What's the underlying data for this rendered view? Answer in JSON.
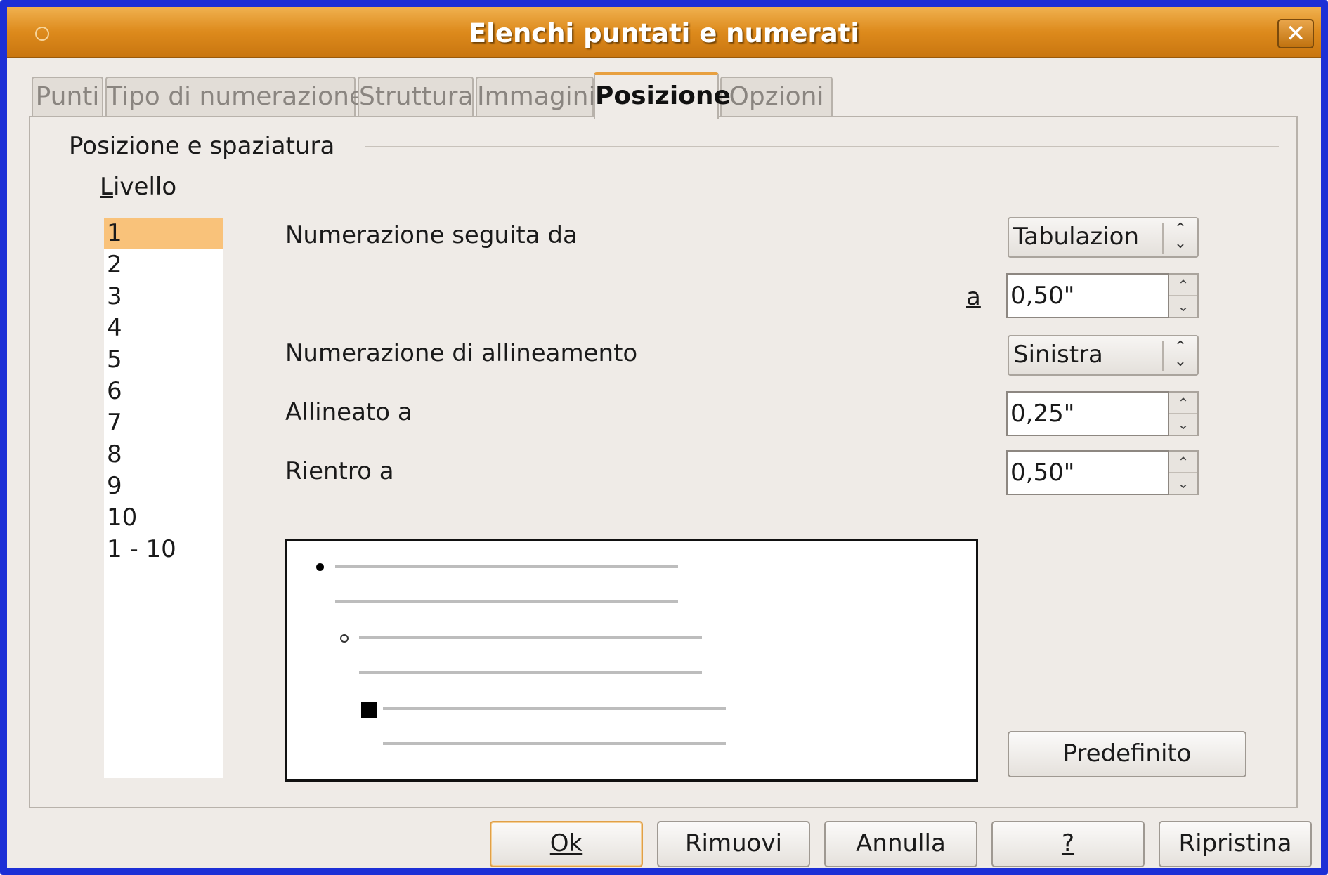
{
  "window": {
    "title": "Elenchi puntati e numerati"
  },
  "tabs": [
    {
      "label": "Punti"
    },
    {
      "label": "Tipo di numerazione"
    },
    {
      "label": "Struttura"
    },
    {
      "label": "Immagini"
    },
    {
      "label": "Posizione",
      "active": true
    },
    {
      "label": "Opzioni"
    }
  ],
  "section": {
    "title": "Posizione e spaziatura",
    "level_label": "Livello",
    "levels": [
      "1",
      "2",
      "3",
      "4",
      "5",
      "6",
      "7",
      "8",
      "9",
      "10",
      "1 - 10"
    ],
    "selected_level": "1"
  },
  "fields": {
    "followed_by_label": "Numerazione seguita da",
    "followed_by_value": "Tabulazion",
    "at_label": "a",
    "at_value": "0,50\"",
    "alignment_label": "Numerazione di allineamento",
    "alignment_value": "Sinistra",
    "aligned_at_label": "Allineato a",
    "aligned_at_value": "0,25\"",
    "indent_at_label": "Rientro a",
    "indent_at_value": "0,50\""
  },
  "buttons": {
    "default": "Predefinito",
    "ok": "Ok",
    "remove": "Rimuovi",
    "cancel": "Annulla",
    "help": "?",
    "reset": "Ripristina"
  },
  "colors": {
    "titlebar": "#dd8a1c",
    "window_border": "#1c2fd6",
    "selection": "#f9c27a",
    "dialog_bg": "#efebe7"
  }
}
